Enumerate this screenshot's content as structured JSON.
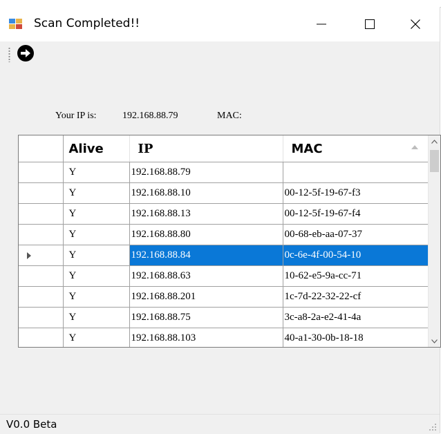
{
  "window": {
    "title": "Scan Completed!!",
    "icons": {
      "app": "network-scan-app-icon",
      "minimize": "minimize-icon",
      "maximize": "maximize-icon",
      "close": "close-icon"
    }
  },
  "toolbar": {
    "go_icon": "arrow-right-circle-icon"
  },
  "info": {
    "ip_label": "Your IP is:",
    "ip_value": "192.168.88.79",
    "mac_label": "MAC:"
  },
  "grid": {
    "columns": [
      "Alive",
      "IP",
      "MAC"
    ],
    "sorted_column": "MAC",
    "selected_row": 4,
    "rows": [
      {
        "alive": "Y",
        "ip": "192.168.88.79",
        "mac": ""
      },
      {
        "alive": "Y",
        "ip": "192.168.88.10",
        "mac": "00-12-5f-19-67-f3"
      },
      {
        "alive": "Y",
        "ip": "192.168.88.13",
        "mac": "00-12-5f-19-67-f4"
      },
      {
        "alive": "Y",
        "ip": "192.168.88.80",
        "mac": "00-68-eb-aa-07-37"
      },
      {
        "alive": "Y",
        "ip": "192.168.88.84",
        "mac": "0c-6e-4f-00-54-10"
      },
      {
        "alive": "Y",
        "ip": "192.168.88.63",
        "mac": "10-62-e5-9a-cc-71"
      },
      {
        "alive": "Y",
        "ip": "192.168.88.201",
        "mac": "1c-7d-22-32-22-cf"
      },
      {
        "alive": "Y",
        "ip": "192.168.88.75",
        "mac": "3c-a8-2a-e2-41-4a"
      },
      {
        "alive": "Y",
        "ip": "192.168.88.103",
        "mac": "40-a1-30-0b-18-18"
      }
    ]
  },
  "status": {
    "version": "V0.0 Beta"
  },
  "colors": {
    "selection": "#0a78d7",
    "window_bg": "#f0f0f0"
  }
}
